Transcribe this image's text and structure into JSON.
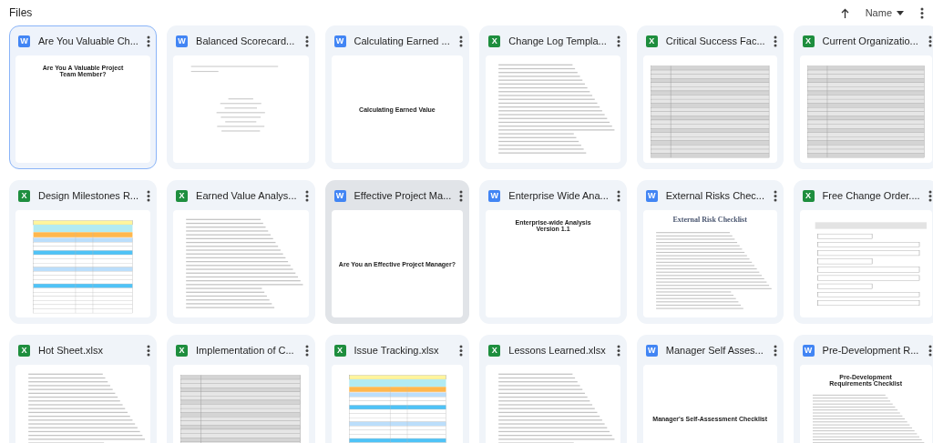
{
  "header": {
    "title": "Files",
    "sort_label": "Name"
  },
  "files": [
    {
      "kind": "doc",
      "badge": "W",
      "title": "Are You Valuable Ch...",
      "selected": true,
      "hovered": false,
      "preview": {
        "kind": "title-top",
        "heading": "Are You A Valuable Project Team Member?"
      }
    },
    {
      "kind": "doc",
      "badge": "W",
      "title": "Balanced Scorecard...",
      "selected": false,
      "hovered": false,
      "preview": {
        "kind": "paper"
      }
    },
    {
      "kind": "doc",
      "badge": "W",
      "title": "Calculating Earned ...",
      "selected": false,
      "hovered": false,
      "preview": {
        "kind": "title-center",
        "heading": "Calculating Earned Value"
      }
    },
    {
      "kind": "sheet",
      "badge": "X",
      "title": "Change Log Templa...",
      "selected": false,
      "hovered": false,
      "preview": {
        "kind": "text"
      }
    },
    {
      "kind": "sheet",
      "badge": "X",
      "title": "Critical Success Fac...",
      "selected": false,
      "hovered": false,
      "preview": {
        "kind": "sheet"
      }
    },
    {
      "kind": "sheet",
      "badge": "X",
      "title": "Current Organizatio...",
      "selected": false,
      "hovered": false,
      "preview": {
        "kind": "sheet"
      }
    },
    {
      "kind": "sheet",
      "badge": "X",
      "title": "Design Milestones R...",
      "selected": false,
      "hovered": false,
      "preview": {
        "kind": "sheet-color"
      }
    },
    {
      "kind": "sheet",
      "badge": "X",
      "title": "Earned Value Analys...",
      "selected": false,
      "hovered": false,
      "preview": {
        "kind": "text"
      }
    },
    {
      "kind": "doc",
      "badge": "W",
      "title": "Effective Project Ma...",
      "selected": false,
      "hovered": true,
      "preview": {
        "kind": "title-center",
        "heading": "Are You an Effective Project Manager?"
      }
    },
    {
      "kind": "doc",
      "badge": "W",
      "title": "Enterprise Wide Ana...",
      "selected": false,
      "hovered": false,
      "preview": {
        "kind": "title-top",
        "heading": "Enterprise-wide Analysis Version 1.1"
      }
    },
    {
      "kind": "doc",
      "badge": "W",
      "title": "External Risks Chec...",
      "selected": false,
      "hovered": false,
      "preview": {
        "kind": "text",
        "heading": "External Risk Checklist"
      }
    },
    {
      "kind": "sheet",
      "badge": "X",
      "title": "Free Change Order....",
      "selected": false,
      "hovered": false,
      "preview": {
        "kind": "form"
      }
    },
    {
      "kind": "sheet",
      "badge": "X",
      "title": "Hot Sheet.xlsx",
      "selected": false,
      "hovered": false,
      "preview": {
        "kind": "text"
      }
    },
    {
      "kind": "sheet",
      "badge": "X",
      "title": "Implementation of C...",
      "selected": false,
      "hovered": false,
      "preview": {
        "kind": "sheet"
      }
    },
    {
      "kind": "sheet",
      "badge": "X",
      "title": "Issue Tracking.xlsx",
      "selected": false,
      "hovered": false,
      "preview": {
        "kind": "sheet-color"
      }
    },
    {
      "kind": "sheet",
      "badge": "X",
      "title": "Lessons Learned.xlsx",
      "selected": false,
      "hovered": false,
      "preview": {
        "kind": "text"
      }
    },
    {
      "kind": "doc",
      "badge": "W",
      "title": "Manager Self Asses...",
      "selected": false,
      "hovered": false,
      "preview": {
        "kind": "title-center",
        "heading": "Manager's Self-Assessment Checklist"
      }
    },
    {
      "kind": "doc",
      "badge": "W",
      "title": "Pre-Development R...",
      "selected": false,
      "hovered": false,
      "preview": {
        "kind": "text",
        "heading": "Pre-Development Requirements Checklist"
      }
    }
  ]
}
